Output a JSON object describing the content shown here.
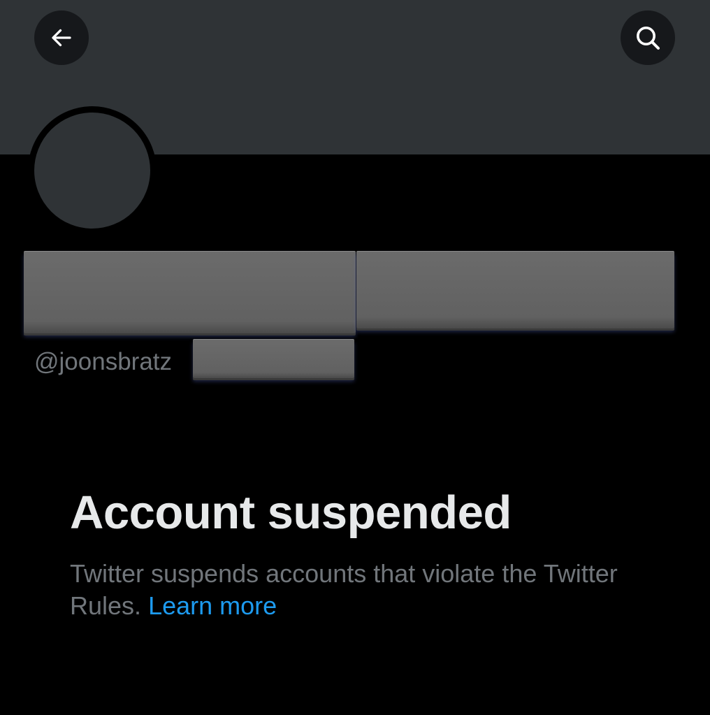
{
  "profile": {
    "handle": "@joonsbratz",
    "redacted_blocks": [
      "display-name-redaction",
      "display-name-redaction-2",
      "handle-redaction"
    ]
  },
  "nav": {
    "back_icon": "arrow-left-icon",
    "search_icon": "search-icon"
  },
  "notice": {
    "title": "Account suspended",
    "body": "Twitter suspends accounts that violate the Twitter Rules.",
    "link": "Learn more"
  },
  "colors": {
    "background": "#000000",
    "banner": "#2f3336",
    "avatar": "#2f3336",
    "title_text": "#e7e9ea",
    "secondary_text": "#71767b",
    "link": "#1d9bf0",
    "redaction": "#656565"
  }
}
